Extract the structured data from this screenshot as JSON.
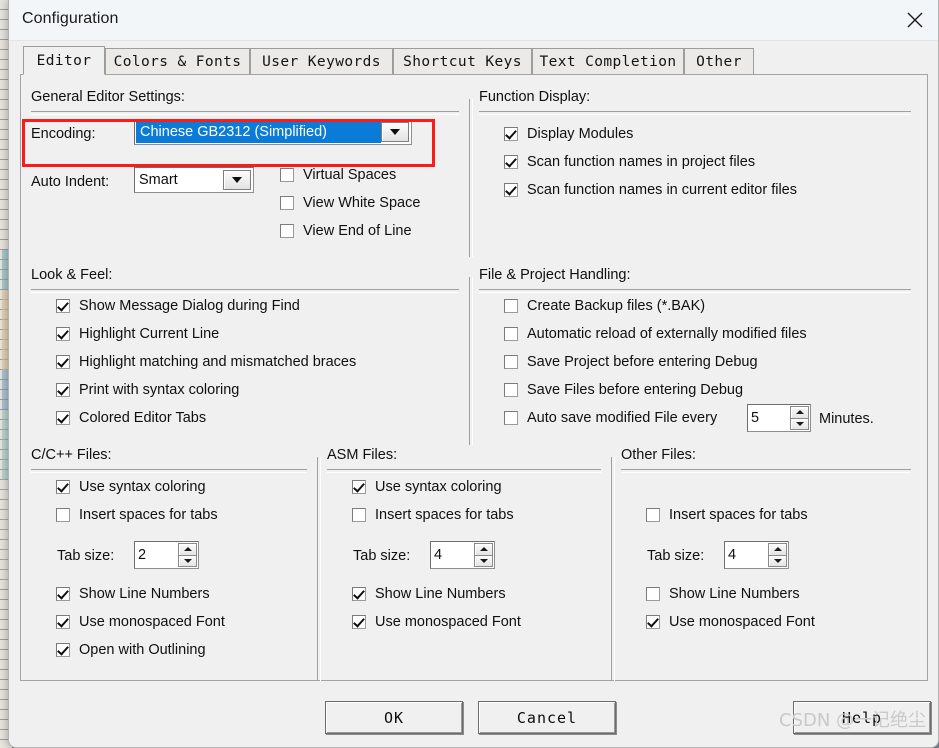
{
  "window": {
    "title": "Configuration",
    "close_icon": "close-icon"
  },
  "tabs": [
    {
      "label": "Editor",
      "active": true
    },
    {
      "label": "Colors & Fonts",
      "active": false
    },
    {
      "label": "User Keywords",
      "active": false
    },
    {
      "label": "Shortcut Keys",
      "active": false
    },
    {
      "label": "Text Completion",
      "active": false
    },
    {
      "label": "Other",
      "active": false
    }
  ],
  "general_editor_settings": {
    "title": "General Editor Settings:",
    "encoding_label": "Encoding:",
    "encoding_value": "Chinese GB2312 (Simplified)",
    "auto_indent_label": "Auto Indent:",
    "auto_indent_value": "Smart",
    "checkboxes": [
      {
        "label": "Virtual Spaces",
        "checked": false
      },
      {
        "label": "View White Space",
        "checked": false
      },
      {
        "label": "View End of Line",
        "checked": false
      }
    ]
  },
  "function_display": {
    "title": "Function Display:",
    "checkboxes": [
      {
        "label": "Display Modules",
        "checked": true
      },
      {
        "label": "Scan function names in project files",
        "checked": true
      },
      {
        "label": "Scan function names in current editor files",
        "checked": true
      }
    ]
  },
  "look_and_feel": {
    "title": "Look & Feel:",
    "checkboxes": [
      {
        "label": "Show Message Dialog during Find",
        "checked": true
      },
      {
        "label": "Highlight Current Line",
        "checked": true
      },
      {
        "label": "Highlight matching and mismatched braces",
        "checked": true
      },
      {
        "label": "Print with syntax coloring",
        "checked": true
      },
      {
        "label": "Colored Editor Tabs",
        "checked": true
      }
    ]
  },
  "file_project_handling": {
    "title": "File & Project Handling:",
    "checkboxes": [
      {
        "label": "Create Backup files (*.BAK)",
        "checked": false
      },
      {
        "label": "Automatic reload of externally modified files",
        "checked": false
      },
      {
        "label": "Save Project before entering Debug",
        "checked": false
      },
      {
        "label": "Save Files before entering Debug",
        "checked": false
      },
      {
        "label": "Auto save modified File every",
        "checked": false
      }
    ],
    "autosave_minutes": "5",
    "minutes_suffix": "Minutes."
  },
  "c_cpp_files": {
    "title": "C/C++ Files:",
    "use_syntax_coloring": {
      "label": "Use syntax coloring",
      "checked": true
    },
    "insert_spaces": {
      "label": "Insert spaces for tabs",
      "checked": false
    },
    "tab_size_label": "Tab size:",
    "tab_size_value": "2",
    "show_line_numbers": {
      "label": "Show Line Numbers",
      "checked": true
    },
    "use_monospaced": {
      "label": "Use monospaced Font",
      "checked": true
    },
    "open_with_outlining": {
      "label": "Open with Outlining",
      "checked": true
    }
  },
  "asm_files": {
    "title": "ASM Files:",
    "use_syntax_coloring": {
      "label": "Use syntax coloring",
      "checked": true
    },
    "insert_spaces": {
      "label": "Insert spaces for tabs",
      "checked": false
    },
    "tab_size_label": "Tab size:",
    "tab_size_value": "4",
    "show_line_numbers": {
      "label": "Show Line Numbers",
      "checked": true
    },
    "use_monospaced": {
      "label": "Use monospaced Font",
      "checked": true
    }
  },
  "other_files": {
    "title": "Other Files:",
    "insert_spaces": {
      "label": "Insert spaces for tabs",
      "checked": false
    },
    "tab_size_label": "Tab size:",
    "tab_size_value": "4",
    "show_line_numbers": {
      "label": "Show Line Numbers",
      "checked": false
    },
    "use_monospaced": {
      "label": "Use monospaced Font",
      "checked": true
    }
  },
  "footer": {
    "ok": "OK",
    "cancel": "Cancel",
    "help": "Help"
  },
  "watermark": "CSDN @一记绝尘",
  "colors": {
    "accent_selection": "#0a7cd8",
    "annotation_red": "#fc1a1a",
    "dialog_bg": "#f0f0f0",
    "titlebar_bg": "#f3f6f8"
  }
}
